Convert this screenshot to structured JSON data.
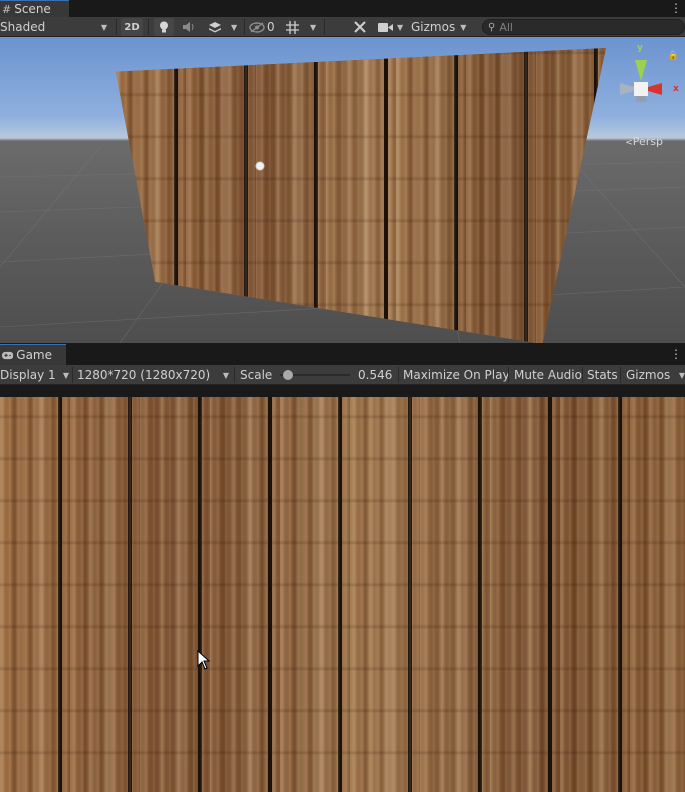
{
  "scene_tab": {
    "label": "Scene",
    "icon": "hash-icon"
  },
  "scene_toolbar": {
    "shading_mode": "Shaded",
    "mode_2d_label": "2D",
    "hidden_count": "0",
    "gizmos_label": "Gizmos",
    "search_placeholder": "All"
  },
  "scene_view": {
    "gizmo_axes": {
      "y": "y",
      "x": "x"
    },
    "projection_label": "Persp"
  },
  "game_tab": {
    "label": "Game",
    "icon": "gamepad-icon"
  },
  "game_toolbar": {
    "display": "Display 1",
    "resolution": "1280*720 (1280x720)",
    "scale_label": "Scale",
    "scale_value": "0.546",
    "scale_fraction": 0.05,
    "maximize_on_play_label": "Maximize On Play",
    "mute_audio_label": "Mute Audio",
    "stats_label": "Stats",
    "gizmos_label": "Gizmos"
  },
  "colors": {
    "panel_bg": "#383838",
    "toolbar_bg": "#3c3c3c",
    "active_tab_accent": "#3d6fb3",
    "gizmo_y": "#9bd14f",
    "gizmo_x": "#d9342a"
  }
}
